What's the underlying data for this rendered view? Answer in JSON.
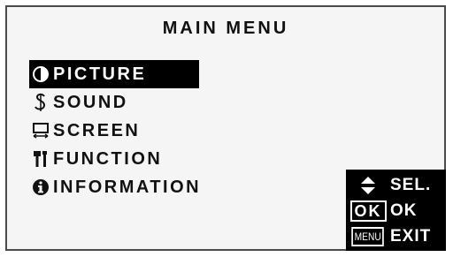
{
  "title": "MAIN MENU",
  "menu": {
    "items": [
      {
        "label": "PICTURE",
        "icon": "contrast-icon",
        "selected": true
      },
      {
        "label": "SOUND",
        "icon": "music-note-icon",
        "selected": false
      },
      {
        "label": "SCREEN",
        "icon": "screen-size-icon",
        "selected": false
      },
      {
        "label": "FUNCTION",
        "icon": "tools-icon",
        "selected": false
      },
      {
        "label": "INFORMATION",
        "icon": "info-icon",
        "selected": false
      }
    ]
  },
  "help": {
    "sel": {
      "key": "up-down-arrows-icon",
      "label": "SEL."
    },
    "ok": {
      "key": "OK",
      "label": "OK"
    },
    "exit": {
      "key": "MENU",
      "label": "EXIT"
    }
  },
  "colors": {
    "background": "#f5f5f5",
    "highlight": "#000000",
    "text": "#111111",
    "border": "#4a4a4a"
  }
}
